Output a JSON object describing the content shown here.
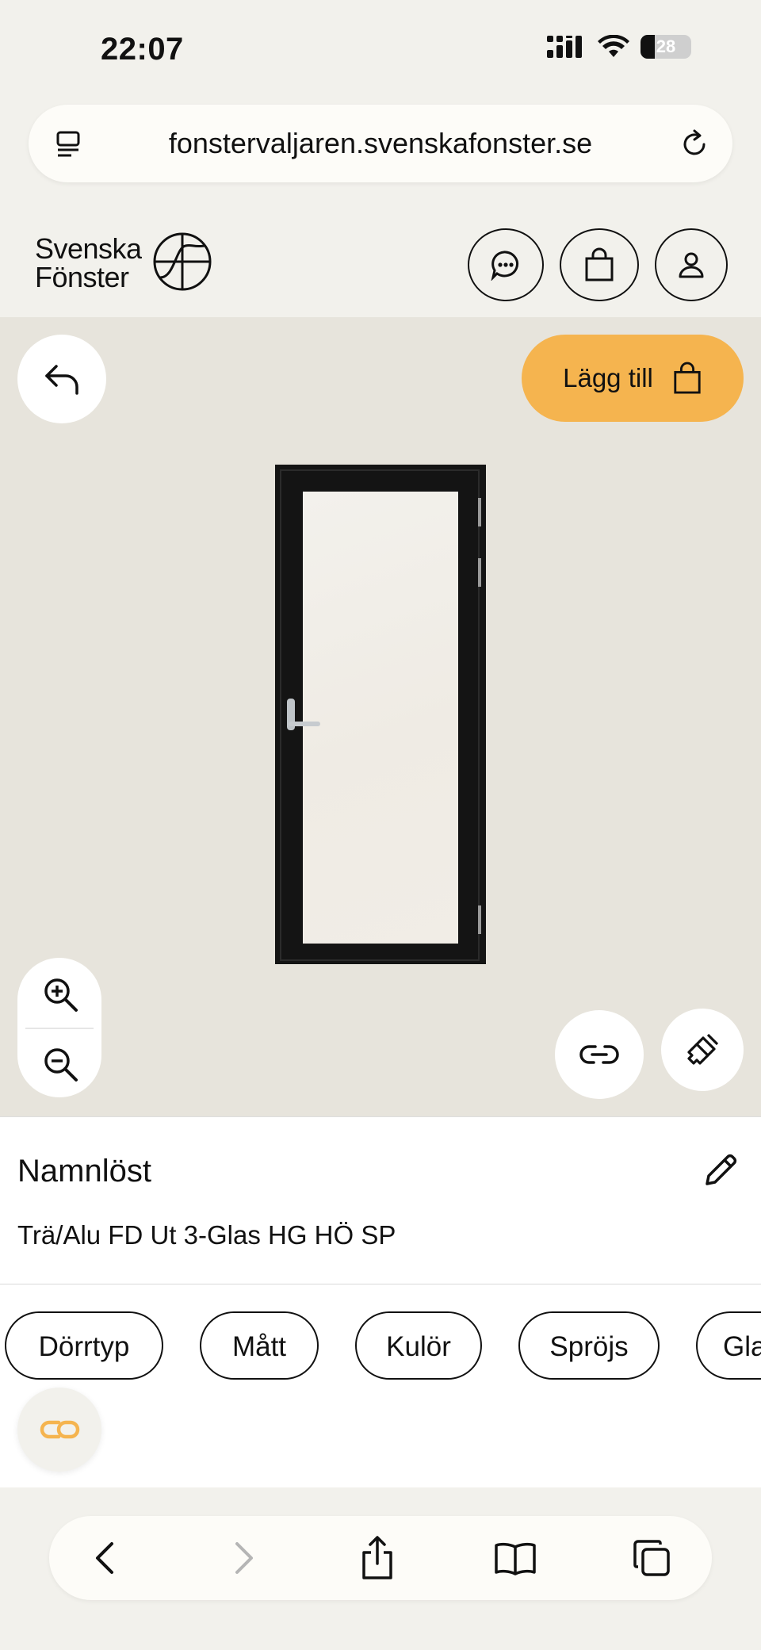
{
  "status_bar": {
    "time": "22:07",
    "battery": "28"
  },
  "browser": {
    "url": "fonstervaljaren.svenskafonster.se"
  },
  "brand": {
    "line1": "Svenska",
    "line2": "Fönster"
  },
  "actions": {
    "add_label": "Lägg till"
  },
  "product": {
    "name": "Namnlöst",
    "description": "Trä/Alu FD Ut 3-Glas HG HÖ SP"
  },
  "tabs": [
    "Dörrtyp",
    "Mått",
    "Kulör",
    "Spröjs",
    "Glas"
  ],
  "colors": {
    "accent": "#f5b44f",
    "viewer_bg": "#e7e4dc",
    "page_bg": "#f2f1ec",
    "frame": "#141414"
  },
  "icons": [
    "tabs-icon",
    "reload-icon",
    "chat-icon",
    "bag-icon",
    "user-icon",
    "undo-icon",
    "zoom-in-icon",
    "zoom-out-icon",
    "link-icon",
    "brush-icon",
    "pencil-icon",
    "back-icon",
    "forward-icon",
    "share-icon",
    "bookmarks-icon",
    "tabs-overview-icon"
  ]
}
